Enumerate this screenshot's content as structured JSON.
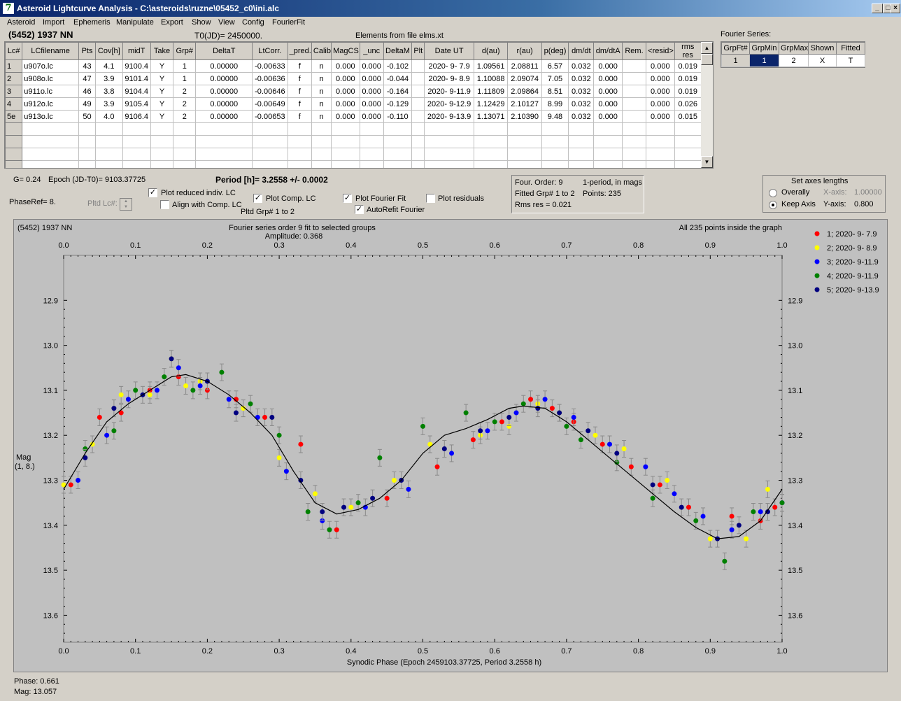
{
  "window": {
    "title": "Asteroid Lightcurve Analysis - C:\\asteroids\\ruzne\\05452_c0\\ini.alc",
    "icon_text": "7",
    "min_label": "_",
    "max_label": "□",
    "close_label": "×"
  },
  "menu": [
    "Asteroid",
    "Import",
    "Ephemeris",
    "Manipulate",
    "Export",
    "Show",
    "View",
    "Config",
    "FourierFit"
  ],
  "header": {
    "asteroid_name": "(5452) 1937 NN",
    "t0": "T0(JD)= 2450000.",
    "elements": "Elements from file elms.xt",
    "fourier_series_label": "Fourier Series:"
  },
  "lc_table": {
    "columns": [
      "Lc#",
      "LCfilename",
      "Pts",
      "Cov[h]",
      "midT",
      "Take",
      "Grp#",
      "DeltaT",
      "LtCorr.",
      "_pred.",
      "Calib.",
      "MagCS",
      "_unc",
      "DeltaM",
      "Plt",
      "Date UT",
      "d(au)",
      "r(au)",
      "p(deg)",
      "dm/dt",
      "dm/dtA",
      "Rem.",
      "<resid>",
      "rms res"
    ],
    "rows": [
      [
        "1",
        "u907o.lc",
        "43",
        "4.1",
        "9100.4",
        "Y",
        "1",
        "0.00000",
        "-0.00633",
        "f",
        "n",
        "0.000",
        "0.000",
        "-0.102",
        "",
        "2020- 9- 7.9",
        "1.09561",
        "2.08811",
        "6.57",
        "0.032",
        "0.000",
        "",
        "0.000",
        "0.019"
      ],
      [
        "2",
        "u908o.lc",
        "47",
        "3.9",
        "9101.4",
        "Y",
        "1",
        "0.00000",
        "-0.00636",
        "f",
        "n",
        "0.000",
        "0.000",
        "-0.044",
        "",
        "2020- 9- 8.9",
        "1.10088",
        "2.09074",
        "7.05",
        "0.032",
        "0.000",
        "",
        "0.000",
        "0.019"
      ],
      [
        "3",
        "u911o.lc",
        "46",
        "3.8",
        "9104.4",
        "Y",
        "2",
        "0.00000",
        "-0.00646",
        "f",
        "n",
        "0.000",
        "0.000",
        "-0.164",
        "",
        "2020- 9-11.9",
        "1.11809",
        "2.09864",
        "8.51",
        "0.032",
        "0.000",
        "",
        "0.000",
        "0.019"
      ],
      [
        "4",
        "u912o.lc",
        "49",
        "3.9",
        "9105.4",
        "Y",
        "2",
        "0.00000",
        "-0.00649",
        "f",
        "n",
        "0.000",
        "0.000",
        "-0.129",
        "",
        "2020- 9-12.9",
        "1.12429",
        "2.10127",
        "8.99",
        "0.032",
        "0.000",
        "",
        "0.000",
        "0.026"
      ],
      [
        "5e",
        "u913o.lc",
        "50",
        "4.0",
        "9106.4",
        "Y",
        "2",
        "0.00000",
        "-0.00653",
        "f",
        "n",
        "0.000",
        "0.000",
        "-0.110",
        "",
        "2020- 9-13.9",
        "1.13071",
        "2.10390",
        "9.48",
        "0.032",
        "0.000",
        "",
        "0.000",
        "0.015"
      ]
    ],
    "empty_rows": 4
  },
  "fourier_table": {
    "columns": [
      "GrpFt#",
      "GrpMin",
      "GrpMax",
      "Shown",
      "Fitted"
    ],
    "row": [
      "1",
      "1",
      "2",
      "X",
      "T"
    ]
  },
  "info": {
    "g": "G= 0.24",
    "epoch": "Epoch (JD-T0)= 9103.37725",
    "period": "Period [h]= 3.2558 +/- 0.0002",
    "phaseref": "PhaseRef= 8.",
    "pltd_lc": "Pltd Lc#:",
    "pltd_grp": "Pltd Grp#  1   to   2"
  },
  "checkboxes": {
    "plot_reduced": {
      "label": "Plot reduced indiv. LC",
      "checked": "✓"
    },
    "align_comp": {
      "label": "Align with Comp. LC",
      "checked": ""
    },
    "plot_comp": {
      "label": "Plot Comp. LC",
      "checked": "✓"
    },
    "plot_fourier": {
      "label": "Plot Fourier Fit",
      "checked": "✓"
    },
    "autorefit": {
      "label": "AutoRefit Fourier",
      "checked": "✓"
    },
    "plot_residuals": {
      "label": "Plot residuals",
      "checked": ""
    }
  },
  "fit_summary": {
    "order": "Four. Order:  9",
    "mode": "1-period, in mags",
    "fitted": "Fitted Grp# 1 to 2",
    "points": "Points: 235",
    "rms": "Rms res     = 0.021"
  },
  "axes_box": {
    "title": "Set axes lengths",
    "overally": "Overally",
    "keep_axis": "Keep Axis",
    "xaxis_label": "X-axis:",
    "xaxis_value": "1.00000",
    "yaxis_label": "Y-axis:",
    "yaxis_value": "0.800",
    "selected": "keep_axis"
  },
  "status": {
    "phase": "Phase:  0.661",
    "mag": "Mag:    13.057"
  },
  "chart_data": {
    "type": "scatter",
    "title": "(5452) 1937 NN",
    "subtitle": "Fourier series order 9 fit to selected groups",
    "amplitude": "Amplitude: 0.368",
    "note": "All 235 points inside the graph",
    "xlabel": "Synodic Phase (Epoch 2459103.37725, Period 3.2558 h)",
    "ylabel": "Mag",
    "ylabel2": "(1, 8.)",
    "xlim": [
      0,
      1
    ],
    "ylim": [
      12.8,
      13.66
    ],
    "y_inverted": true,
    "x_ticks": [
      "0.0",
      "0.1",
      "0.2",
      "0.3",
      "0.4",
      "0.5",
      "0.6",
      "0.7",
      "0.8",
      "0.9",
      "1.0"
    ],
    "y_ticks": [
      "12.9",
      "13.0",
      "13.1",
      "13.2",
      "13.3",
      "13.4",
      "13.5",
      "13.6"
    ],
    "grid": false,
    "legend_placement": "right",
    "series": [
      {
        "name": "1; 2020- 9- 7.9",
        "color": "#ff0000",
        "x": [
          0.01,
          0.05,
          0.08,
          0.12,
          0.16,
          0.2,
          0.24,
          0.28,
          0.33,
          0.38,
          0.45,
          0.52,
          0.57,
          0.61,
          0.65,
          0.68,
          0.71,
          0.75,
          0.79,
          0.83,
          0.87,
          0.93,
          0.97,
          0.99
        ],
        "y": [
          13.31,
          13.16,
          13.15,
          13.1,
          13.07,
          13.1,
          13.12,
          13.16,
          13.22,
          13.41,
          13.34,
          13.27,
          13.21,
          13.17,
          13.12,
          13.14,
          13.17,
          13.22,
          13.27,
          13.31,
          13.36,
          13.38,
          13.39,
          13.36
        ]
      },
      {
        "name": "2; 2020- 9- 8.9",
        "color": "#ffff00",
        "x": [
          0.0,
          0.04,
          0.08,
          0.12,
          0.15,
          0.17,
          0.19,
          0.25,
          0.3,
          0.35,
          0.4,
          0.46,
          0.51,
          0.58,
          0.62,
          0.66,
          0.69,
          0.74,
          0.78,
          0.84,
          0.9,
          0.95,
          0.98
        ],
        "y": [
          13.31,
          13.22,
          13.11,
          13.11,
          13.03,
          13.09,
          13.08,
          13.14,
          13.25,
          13.33,
          13.36,
          13.3,
          13.22,
          13.2,
          13.18,
          13.13,
          13.15,
          13.2,
          13.23,
          13.3,
          13.43,
          13.43,
          13.32
        ]
      },
      {
        "name": "3; 2020- 9-11.9",
        "color": "#0000ff",
        "x": [
          0.02,
          0.06,
          0.09,
          0.13,
          0.16,
          0.19,
          0.23,
          0.27,
          0.31,
          0.36,
          0.42,
          0.48,
          0.54,
          0.59,
          0.63,
          0.67,
          0.71,
          0.76,
          0.81,
          0.85,
          0.89,
          0.93,
          0.97,
          1.0
        ],
        "y": [
          13.3,
          13.2,
          13.12,
          13.1,
          13.05,
          13.09,
          13.12,
          13.16,
          13.28,
          13.39,
          13.36,
          13.32,
          13.24,
          13.19,
          13.15,
          13.12,
          13.16,
          13.22,
          13.27,
          13.33,
          13.38,
          13.41,
          13.37,
          13.35
        ]
      },
      {
        "name": "4; 2020- 9-11.9",
        "color": "#008000",
        "x": [
          0.03,
          0.07,
          0.1,
          0.14,
          0.18,
          0.22,
          0.26,
          0.3,
          0.34,
          0.37,
          0.41,
          0.44,
          0.5,
          0.56,
          0.6,
          0.64,
          0.7,
          0.72,
          0.77,
          0.82,
          0.88,
          0.92,
          0.96,
          1.0
        ],
        "y": [
          13.23,
          13.19,
          13.1,
          13.07,
          13.1,
          13.06,
          13.13,
          13.2,
          13.37,
          13.41,
          13.35,
          13.25,
          13.18,
          13.15,
          13.17,
          13.13,
          13.18,
          13.21,
          13.26,
          13.34,
          13.39,
          13.48,
          13.37,
          13.35
        ]
      },
      {
        "name": "5; 2020- 9-13.9",
        "color": "#000080",
        "x": [
          0.03,
          0.07,
          0.11,
          0.15,
          0.2,
          0.24,
          0.29,
          0.33,
          0.36,
          0.39,
          0.43,
          0.47,
          0.53,
          0.58,
          0.62,
          0.66,
          0.69,
          0.73,
          0.77,
          0.82,
          0.86,
          0.91,
          0.94,
          0.98
        ],
        "y": [
          13.25,
          13.14,
          13.11,
          13.03,
          13.08,
          13.15,
          13.16,
          13.3,
          13.37,
          13.36,
          13.34,
          13.3,
          13.23,
          13.19,
          13.16,
          13.14,
          13.15,
          13.19,
          13.24,
          13.31,
          13.36,
          13.43,
          13.4,
          13.37
        ]
      }
    ],
    "fit_curve": {
      "x": [
        0,
        0.03,
        0.06,
        0.09,
        0.12,
        0.15,
        0.17,
        0.2,
        0.23,
        0.26,
        0.29,
        0.32,
        0.35,
        0.38,
        0.41,
        0.44,
        0.47,
        0.5,
        0.53,
        0.56,
        0.59,
        0.62,
        0.64,
        0.67,
        0.7,
        0.73,
        0.76,
        0.79,
        0.82,
        0.85,
        0.88,
        0.91,
        0.94,
        0.97,
        1.0
      ],
      "y": [
        13.32,
        13.24,
        13.17,
        13.13,
        13.1,
        13.07,
        13.065,
        13.08,
        13.11,
        13.15,
        13.2,
        13.28,
        13.35,
        13.375,
        13.365,
        13.34,
        13.3,
        13.24,
        13.2,
        13.185,
        13.165,
        13.14,
        13.135,
        13.14,
        13.17,
        13.21,
        13.25,
        13.29,
        13.33,
        13.37,
        13.405,
        13.43,
        13.425,
        13.39,
        13.32
      ]
    }
  }
}
